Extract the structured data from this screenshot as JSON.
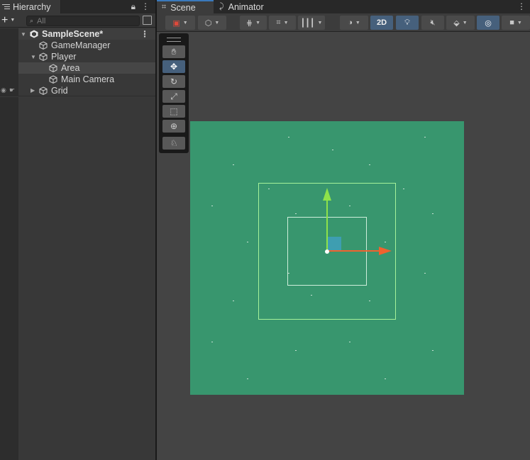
{
  "hierarchy": {
    "tab_title": "Hierarchy",
    "search_placeholder": "All",
    "scene_name": "SampleScene*",
    "items": [
      {
        "label": "GameManager"
      },
      {
        "label": "Player"
      },
      {
        "label": "Area"
      },
      {
        "label": "Main Camera"
      },
      {
        "label": "Grid"
      }
    ]
  },
  "scene_view": {
    "tabs": [
      {
        "label": "Scene"
      },
      {
        "label": "Animator"
      }
    ],
    "toolbar": {
      "mode_2d_label": "2D"
    }
  },
  "colors": {
    "viewport_bg": "#38966e",
    "selection_accent": "#46607c",
    "gizmo_y": "#8ee24a",
    "gizmo_x": "#f0622e",
    "bounds_outer": "#a6f29a",
    "bounds_inner": "#cfeedb"
  }
}
